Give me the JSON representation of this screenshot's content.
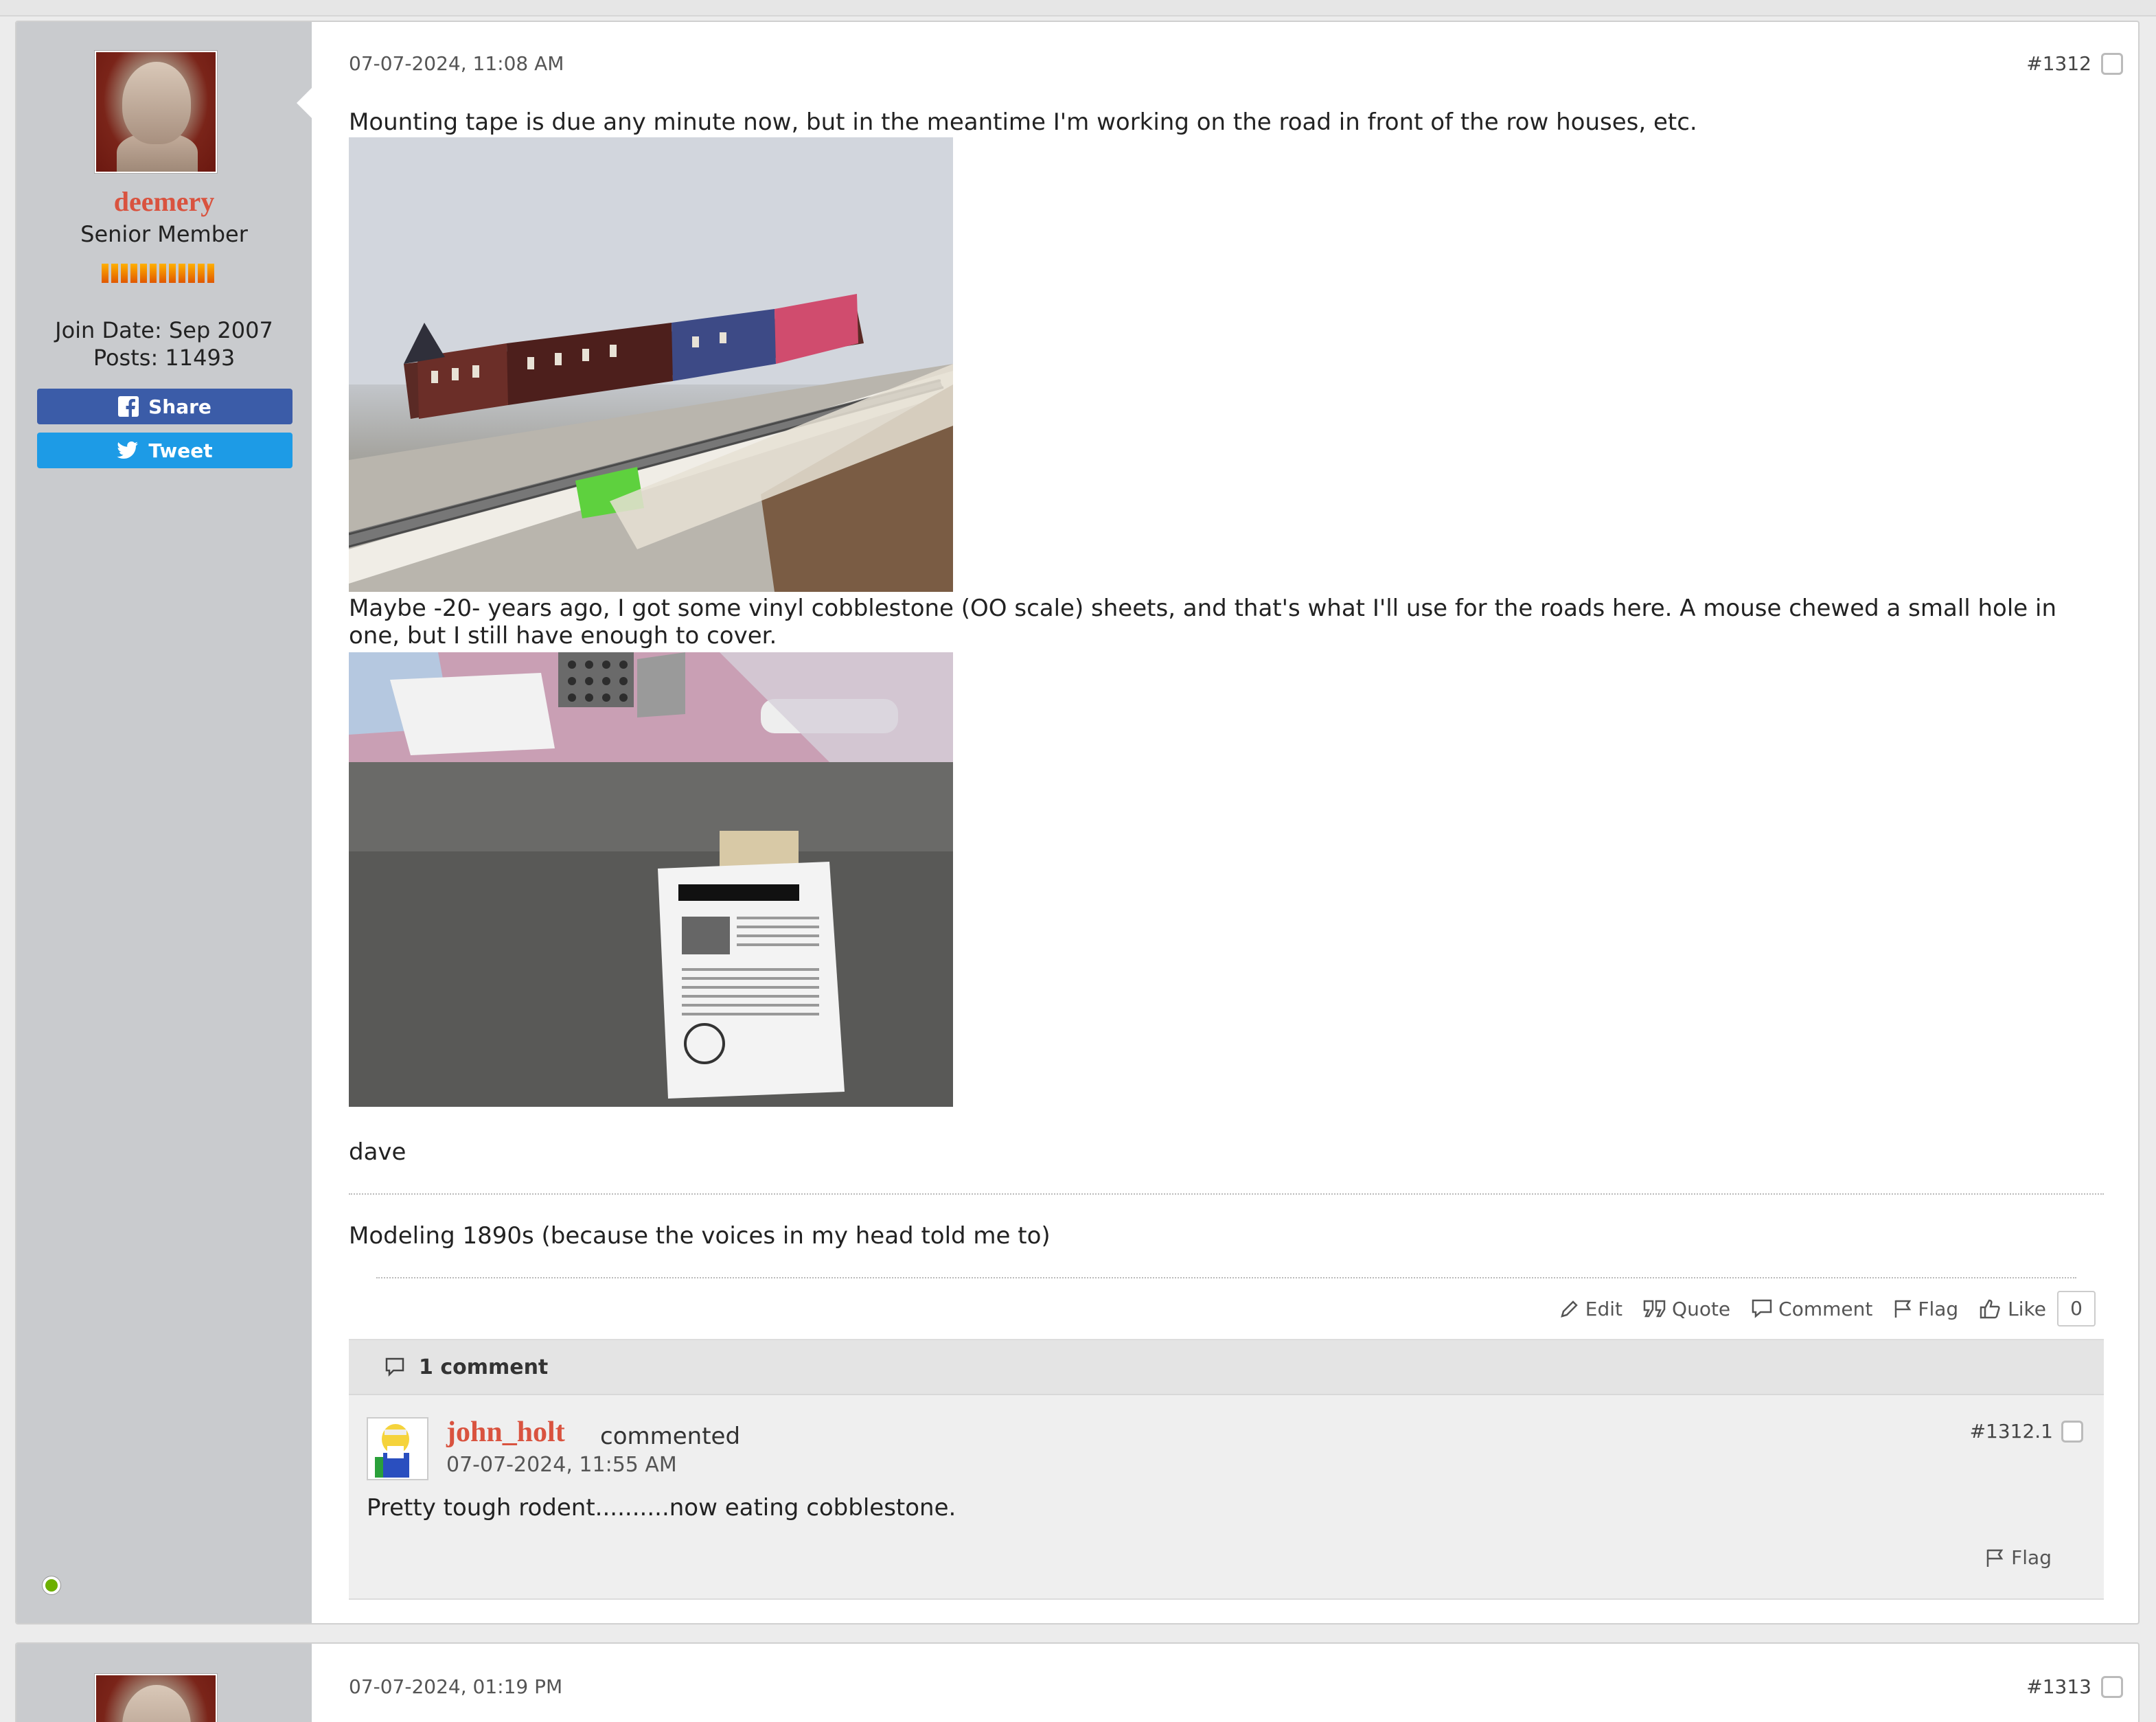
{
  "post1": {
    "author": {
      "username": "deemery",
      "rank": "Senior Member",
      "join_date": "Join Date: Sep 2007",
      "posts": "Posts: 11493",
      "share_label": "Share",
      "tweet_label": "Tweet"
    },
    "date": "07-07-2024, 11:08 AM",
    "post_number": "#1312",
    "text1": "Mounting tape is due any minute now, but in the meantime I'm working on the road in front of the row houses, etc.",
    "text2": "Maybe -20- years ago, I got some vinyl cobblestone (OO scale) sheets, and that's what I'll use for the roads here. A mouse chewed a small hole in one, but I still have enough to cover.",
    "signoff": "dave",
    "signature": "Modeling 1890s (because the voices in my head told me to)",
    "actions": {
      "edit": "Edit",
      "quote": "Quote",
      "comment": "Comment",
      "flag": "Flag",
      "like": "Like",
      "like_count": "0"
    },
    "comments": {
      "header": "1 comment",
      "items": [
        {
          "username": "john_holt",
          "verb": "commented",
          "date": "07-07-2024, 11:55 AM",
          "number": "#1312.1",
          "text": "Pretty tough rodent..........now eating cobblestone.",
          "flag": "Flag"
        }
      ]
    }
  },
  "post2": {
    "date": "07-07-2024, 01:19 PM",
    "post_number": "#1313"
  },
  "colors": {
    "username": "#d9533f",
    "facebook": "#3b5ca8",
    "twitter": "#1d9be6",
    "online": "#6cb000",
    "sidebar": "#c9cbce"
  },
  "icons": [
    "facebook-icon",
    "twitter-icon",
    "edit-icon",
    "quote-icon",
    "comment-icon",
    "flag-icon",
    "like-icon",
    "comment-bubble-icon"
  ]
}
